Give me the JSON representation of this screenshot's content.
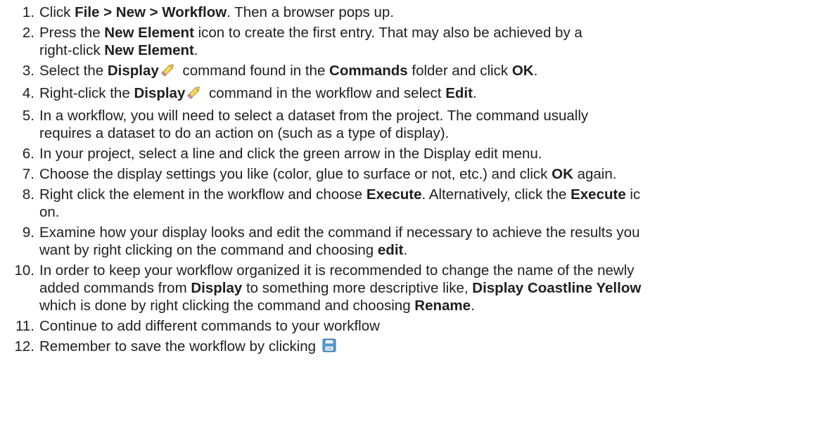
{
  "steps": [
    {
      "n": "1.",
      "parts": [
        {
          "t": "Click "
        },
        {
          "t": "File > New > Workflow",
          "b": true
        },
        {
          "t": ". Then a browser pops up."
        }
      ]
    },
    {
      "n": "2.",
      "parts": [
        {
          "t": "Press the "
        },
        {
          "t": "New Element",
          "b": true
        },
        {
          "t": " icon to create the first entry. That may also be achieved by a"
        },
        {
          "br": true
        },
        {
          "t": "right-click "
        },
        {
          "t": "New Element",
          "b": true
        },
        {
          "t": "."
        }
      ]
    },
    {
      "n": "3.",
      "parts": [
        {
          "t": "Select the "
        },
        {
          "t": "Display",
          "b": true
        },
        {
          "icon": "pencil-icon"
        },
        {
          "t": " command found in the "
        },
        {
          "t": "Commands",
          "b": true
        },
        {
          "t": " folder and click "
        },
        {
          "t": "OK",
          "b": true
        },
        {
          "t": "."
        }
      ]
    },
    {
      "n": "4.",
      "parts": [
        {
          "t": "Right-click the "
        },
        {
          "t": "Display",
          "b": true
        },
        {
          "icon": "pencil-icon"
        },
        {
          "t": " command in the workflow and select "
        },
        {
          "t": "Edit",
          "b": true
        },
        {
          "t": "."
        }
      ]
    },
    {
      "n": "5.",
      "parts": [
        {
          "t": "In a workflow, you will need to select a dataset from the project. The command usually"
        },
        {
          "br": true
        },
        {
          "t": "requires a dataset to do an action on (such as a type of display)."
        }
      ]
    },
    {
      "n": "6.",
      "parts": [
        {
          "t": "In your project, select a line and click the green arrow in the Display edit menu."
        }
      ]
    },
    {
      "n": "7.",
      "parts": [
        {
          "t": "Choose the display settings you like (color, glue to surface or not, etc.) and click "
        },
        {
          "t": "OK",
          "b": true
        },
        {
          "t": " again."
        }
      ]
    },
    {
      "n": "8.",
      "parts": [
        {
          "t": "Right click the element in the workflow and choose "
        },
        {
          "t": "Execute",
          "b": true
        },
        {
          "t": ". Alternatively, click the "
        },
        {
          "t": "Execute",
          "b": true
        },
        {
          "t": " ic"
        },
        {
          "br": true
        },
        {
          "t": "on."
        }
      ]
    },
    {
      "n": "9.",
      "parts": [
        {
          "t": "Examine how your display looks and edit the command if necessary to achieve the results you"
        },
        {
          "br": true
        },
        {
          "t": "want by right clicking on the command and choosing "
        },
        {
          "t": "edit",
          "b": true
        },
        {
          "t": "."
        }
      ]
    },
    {
      "n": "10.",
      "parts": [
        {
          "t": "In order to keep your workflow organized it is recommended to change the name of the newly"
        },
        {
          "br": true
        },
        {
          "t": "added commands from "
        },
        {
          "t": "Display",
          "b": true
        },
        {
          "t": " to something more descriptive like, "
        },
        {
          "t": "Display Coastline Yellow",
          "b": true
        },
        {
          "br": true
        },
        {
          "t": "which is done by right clicking the command and choosing "
        },
        {
          "t": "Rename",
          "b": true
        },
        {
          "t": "."
        }
      ]
    },
    {
      "n": "11.",
      "parts": [
        {
          "t": "Continue to add different commands to your workflow"
        }
      ]
    },
    {
      "n": "12.",
      "parts": [
        {
          "t": "Remember to save the workflow by clicking "
        },
        {
          "icon": "save-icon"
        }
      ]
    }
  ]
}
